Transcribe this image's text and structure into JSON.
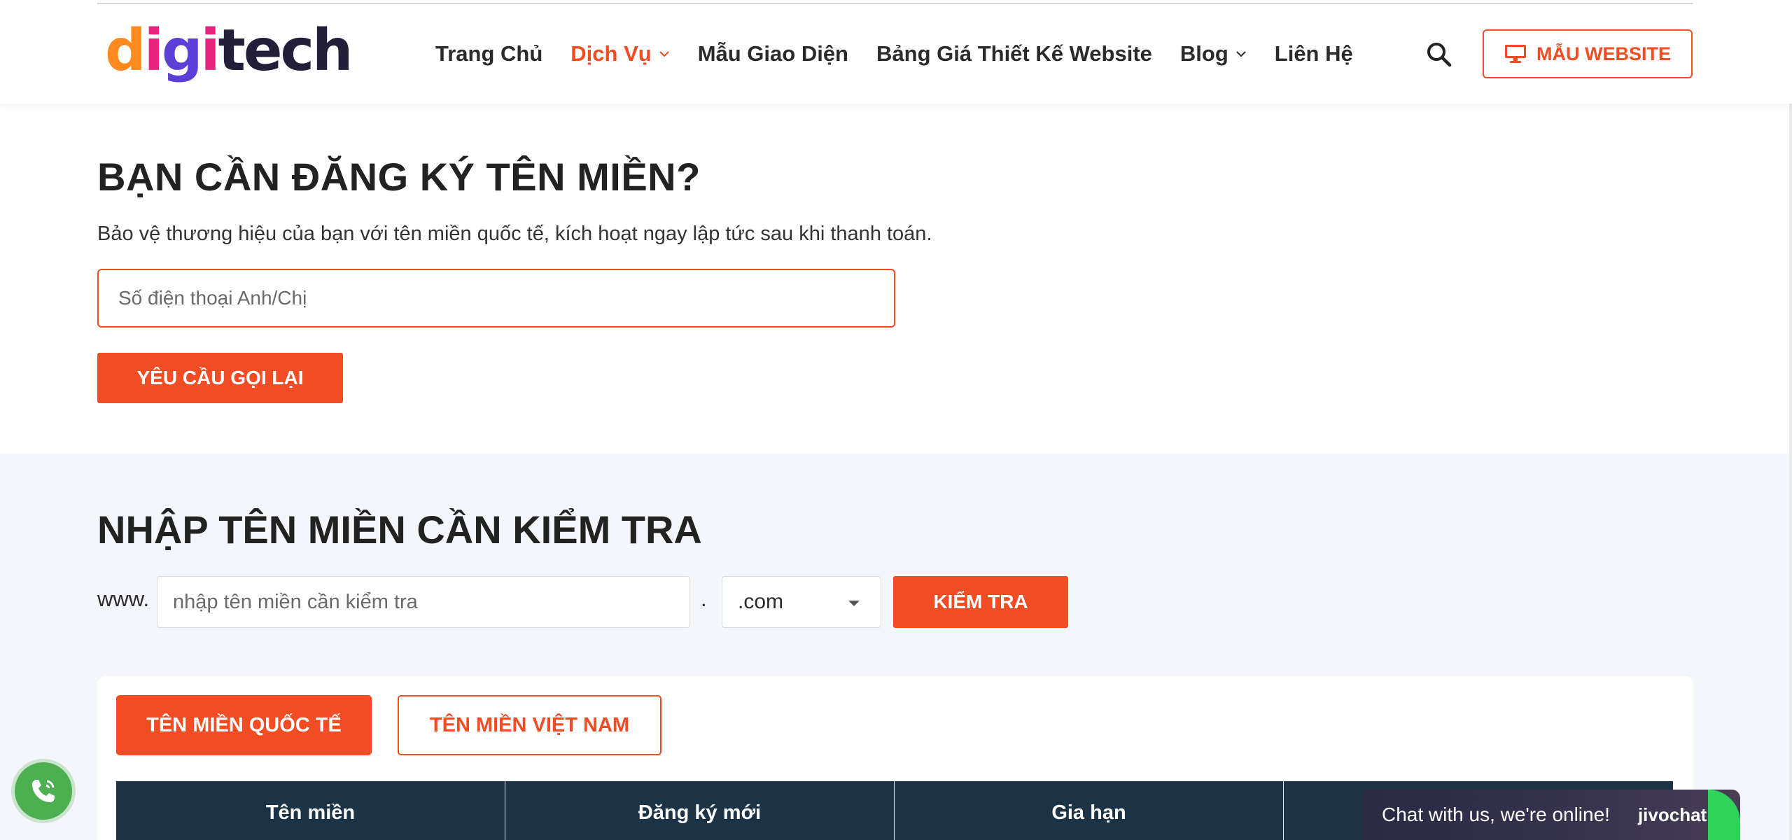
{
  "header": {
    "logo_text": "digitech",
    "nav": [
      {
        "label": "Trang Chủ",
        "active": false,
        "has_dropdown": false
      },
      {
        "label": "Dịch Vụ",
        "active": true,
        "has_dropdown": true
      },
      {
        "label": "Mẫu Giao Diện",
        "active": false,
        "has_dropdown": false
      },
      {
        "label": "Bảng Giá Thiết Kế Website",
        "active": false,
        "has_dropdown": false
      },
      {
        "label": "Blog",
        "active": false,
        "has_dropdown": true
      },
      {
        "label": "Liên Hệ",
        "active": false,
        "has_dropdown": false
      }
    ],
    "search_icon": "search-icon",
    "cta_icon": "monitor-icon",
    "cta_label": "MẪU WEBSITE"
  },
  "register": {
    "title": "BẠN CẦN ĐĂNG KÝ TÊN MIỀN?",
    "subtitle": "Bảo vệ thương hiệu của bạn với tên miền quốc tế, kích hoạt ngay lập tức sau khi thanh toán.",
    "phone_placeholder": "Số điện thoại Anh/Chị",
    "button_label": "YÊU CẦU GỌI LẠI"
  },
  "check": {
    "title": "NHẬP TÊN MIỀN CẦN KIỂM TRA",
    "prefix": "www.",
    "input_placeholder": "nhập tên miền cần kiểm tra",
    "dot": ".",
    "tld_selected": ".com",
    "button_label": "KIỂM TRA"
  },
  "tabs": {
    "international": "TÊN MIỀN QUỐC TẾ",
    "vietnam": "TÊN MIỀN VIỆT NAM"
  },
  "table": {
    "headers": [
      "Tên miền",
      "Đăng ký mới",
      "Gia hạn",
      ""
    ]
  },
  "widgets": {
    "phone_icon": "phone-icon",
    "chat_text": "Chat with us, we're online!",
    "chat_brand": "jivochat"
  },
  "colors": {
    "accent": "#f24c25",
    "table_header": "#1c3346",
    "section_bg": "#f4f6fb",
    "phone_fab": "#4caf50"
  }
}
